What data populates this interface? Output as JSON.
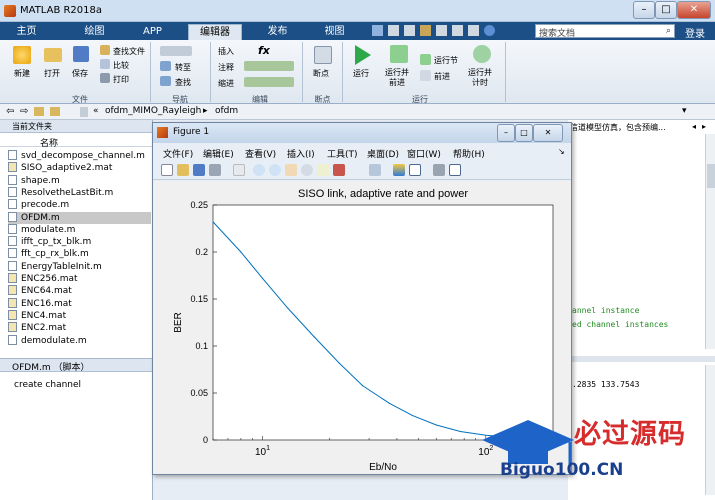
{
  "window": {
    "title": "MATLAB R2018a",
    "btn_min": "–",
    "btn_max": "□",
    "btn_close": "✕"
  },
  "tabs": [
    "主页",
    "绘图",
    "APP",
    "编辑器",
    "发布",
    "视图"
  ],
  "search": {
    "placeholder": "搜索文档",
    "login": "登录"
  },
  "ribbon": {
    "file": {
      "new": "新建",
      "open": "打开",
      "save": "保存",
      "find_files": "查找文件",
      "compare": "比较",
      "print": "打印",
      "group": "文件"
    },
    "nav": {
      "goto": "转至",
      "find": "查找",
      "group": "导航"
    },
    "edit": {
      "insert": "插入",
      "comment": "注释",
      "indent": "缩进",
      "fx": "fx",
      "group": "编辑"
    },
    "breakpoints": {
      "label": "断点",
      "group": "断点"
    },
    "run": {
      "run": "运行",
      "run_advance": "运行并\n前进",
      "run_section": "运行节",
      "advance": "前进",
      "run_time": "运行并\n计时",
      "group": "运行"
    }
  },
  "address": {
    "path": [
      "ofdm_MIMO_Rayleigh",
      "ofdm"
    ]
  },
  "current_folder": {
    "title": "当前文件夹",
    "col_name": "名称",
    "files": [
      "svd_decompose_channel.m",
      "SISO_adaptive2.mat",
      "shape.m",
      "ResolvetheLastBit.m",
      "precode.m",
      "OFDM.m",
      "modulate.m",
      "ifft_cp_tx_blk.m",
      "fft_cp_rx_blk.m",
      "EnergyTableInit.m",
      "ENC256.mat",
      "ENC64.mat",
      "ENC16.mat",
      "ENC4.mat",
      "ENC2.mat",
      "demodulate.m"
    ],
    "selected": "OFDM.m",
    "detail_title": "OFDM.m （脚本）",
    "detail_text": "create channel"
  },
  "right_panel": {
    "header": "信道模型仿真，包含预编...",
    "code1": "annel instance",
    "code2": "ed channel instances",
    "cmd": ".2835   133.7543"
  },
  "figure": {
    "title": "Figure 1",
    "menu": [
      "文件(F)",
      "编辑(E)",
      "查看(V)",
      "插入(I)",
      "工具(T)",
      "桌面(D)",
      "窗口(W)",
      "帮助(H)"
    ]
  },
  "chart_data": {
    "type": "line",
    "title": "SISO link, adaptive rate and power",
    "xlabel": "Eb/No",
    "ylabel": "BER",
    "xscale": "log",
    "xlim": [
      6,
      200
    ],
    "ylim": [
      0,
      0.25
    ],
    "yticks": [
      "0",
      "0.05",
      "0.1",
      "0.15",
      "0.2",
      "0.25"
    ],
    "xticks": [
      "10^1",
      "10^2"
    ],
    "color": "#0072bd",
    "x": [
      6,
      8,
      10,
      13,
      17,
      22,
      28,
      37,
      47,
      60,
      77,
      100,
      130,
      170,
      200
    ],
    "y": [
      0.232,
      0.2,
      0.172,
      0.14,
      0.11,
      0.082,
      0.058,
      0.039,
      0.026,
      0.016,
      0.009,
      0.005,
      0.003,
      0.002,
      0.0015
    ]
  },
  "watermark": {
    "cn": "必过源码",
    "en": "Biguo100.CN"
  }
}
